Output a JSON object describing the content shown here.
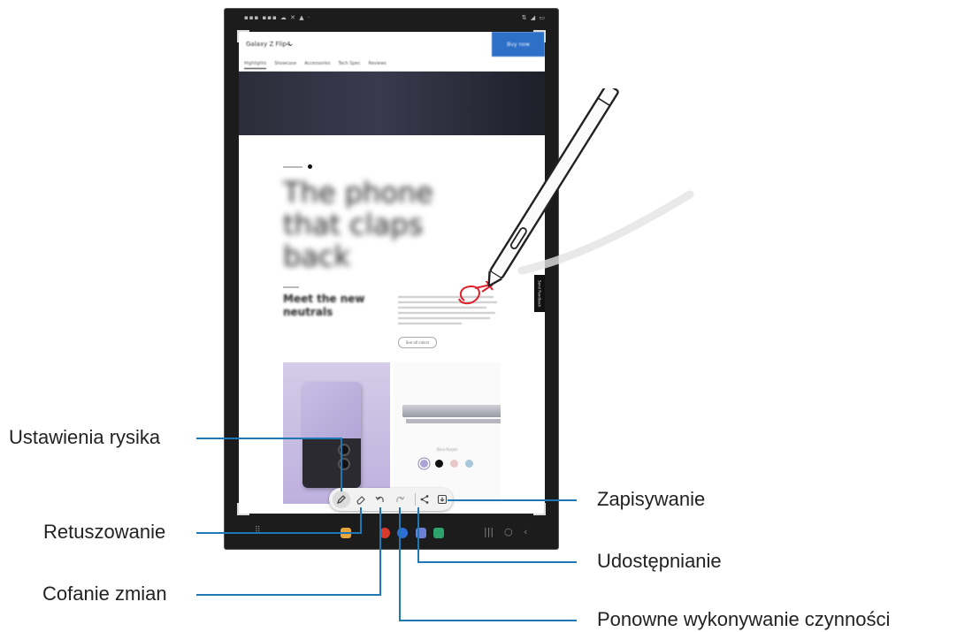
{
  "callouts": {
    "pen_settings": "Ustawienia rysika",
    "eraser": "Retuszowanie",
    "undo": "Cofanie zmian",
    "save": "Zapisywanie",
    "share": "Udostępnianie",
    "redo": "Ponowne wykonywanie czynności"
  },
  "website": {
    "site_name": "Galaxy Z Flip4",
    "buy_label": "Buy now",
    "tabs": [
      "Highlights",
      "Showcase",
      "Accessories",
      "Tech Spec",
      "Reviews"
    ],
    "headline": "The phone that claps back",
    "subheading": "Meet the new neutrals",
    "cta_label": "See all colors",
    "swatch_label": "Bora Purple",
    "feedback_label": "Send Feedback"
  },
  "colors": {
    "accent_blue": "#1f77b4",
    "pen_red": "#e0202a",
    "buy_button": "#2e70c8",
    "swatches": [
      "#a9a3d6",
      "#111111",
      "#e9c8c8",
      "#a8c6d8"
    ]
  },
  "toolbar_icons": [
    "pen-settings-icon",
    "eraser-icon",
    "undo-icon",
    "redo-icon",
    "share-icon",
    "save-icon"
  ]
}
